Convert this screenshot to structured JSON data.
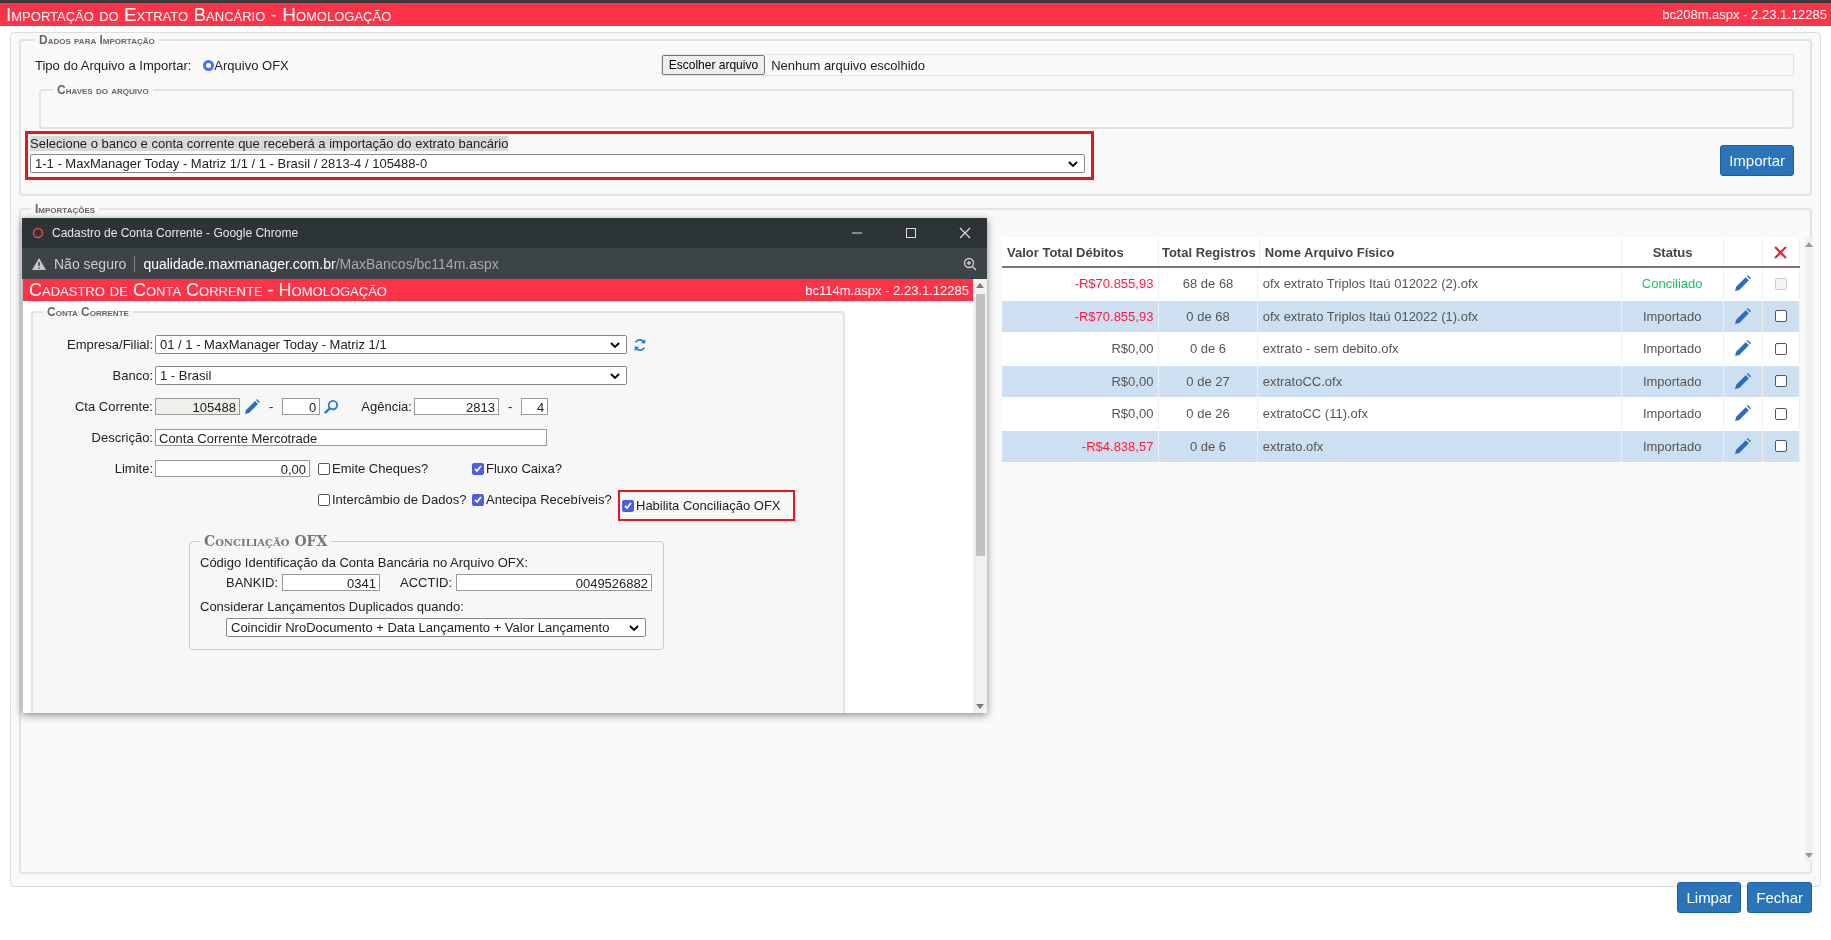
{
  "header": {
    "title": "Importação do Extrato Bancário  - Homologação",
    "file_info": "bc208m.aspx - 2.23.1.12285"
  },
  "dados": {
    "legend": "Dados para Importação",
    "tipo_label": "Tipo do Arquivo a Importar:",
    "radio": {
      "label": "Arquivo OFX",
      "selected": true
    },
    "file_button": "Escolher arquivo",
    "file_status": "Nenhum arquivo escolhido",
    "chaves_legend": "Chaves do arquivo",
    "select_label": "Selecione o banco e conta corrente que receberá a importação do extrato bancário",
    "select_value": "1-1 - MaxManager Today - Matriz 1/1 / 1 - Brasil / 2813-4 / 105488-0",
    "highlighted": true,
    "import_button": "Importar"
  },
  "importacoes": {
    "legend": "Importações",
    "columns": [
      "Valor Total Débitos",
      "Total Registros",
      "Nome Arquivo Físico",
      "Status"
    ],
    "rows": [
      {
        "debit": "-R$70.855,93",
        "negative": true,
        "registros": "68 de 68",
        "file": "ofx extrato Triplos Itaú 012022 (2).ofx",
        "status": "Conciliado",
        "kind": "conciliado",
        "selected": false,
        "checked": false,
        "disabled": true
      },
      {
        "debit": "-R$70.855,93",
        "negative": true,
        "registros": "0 de 68",
        "file": "ofx extrato Triplos Itaú 012022 (1).ofx",
        "status": "Importado",
        "kind": "importado",
        "selected": true,
        "checked": false,
        "disabled": false
      },
      {
        "debit": "R$0,00",
        "negative": false,
        "registros": "0 de 6",
        "file": "extrato - sem debito.ofx",
        "status": "Importado",
        "kind": "importado",
        "selected": false,
        "checked": false,
        "disabled": false
      },
      {
        "debit": "R$0,00",
        "negative": false,
        "registros": "0 de 27",
        "file": "extratoCC.ofx",
        "status": "Importado",
        "kind": "importado",
        "selected": true,
        "checked": false,
        "disabled": false
      },
      {
        "debit": "R$0,00",
        "negative": false,
        "registros": "0 de 26",
        "file": "extratoCC (11).ofx",
        "status": "Importado",
        "kind": "importado",
        "selected": false,
        "checked": false,
        "disabled": false
      },
      {
        "debit": "-R$4.838,57",
        "negative": true,
        "registros": "0 de 6",
        "file": "extrato.ofx",
        "status": "Importado",
        "kind": "importado",
        "selected": true,
        "checked": false,
        "disabled": false
      }
    ]
  },
  "popup": {
    "window_title": "Cadastro de Conta Corrente - Google Chrome",
    "security": "Não seguro",
    "url_host": "qualidade.maxmanager.com.br",
    "url_path": "/MaxBancos/bc114m.aspx",
    "title": "Cadastro de Conta Corrente  - Homologação",
    "file_info": "bc114m.aspx - 2.23.1.12285",
    "legend": "Conta Corrente",
    "empresa_label": "Empresa/Filial:",
    "empresa_value": "01 / 1 - MaxManager Today - Matriz 1/1",
    "banco_label": "Banco:",
    "banco_value": "1 - Brasil",
    "cta_label": "Cta Corrente:",
    "cta_value": "105488",
    "cta_digit": "0",
    "agencia_label": "Agência:",
    "agencia_value": "2813",
    "agencia_digit": "4",
    "dash": "-",
    "descricao_label": "Descrição:",
    "descricao_value": "Conta Corrente Mercotrade",
    "limite_label": "Limite:",
    "limite_value": "0,00",
    "checks": [
      {
        "label": "Emite Cheques?",
        "checked": false
      },
      {
        "label": "Fluxo Caixa?",
        "checked": true
      },
      {
        "label": "Intercâmbio de Dados?",
        "checked": false
      },
      {
        "label": "Antecipa Recebíveis?",
        "checked": true
      },
      {
        "label": "Habilita Conciliação OFX",
        "checked": true,
        "highlighted": true
      }
    ],
    "ofx": {
      "legend": "Conciliação OFX",
      "code_label": "Código Identificação da Conta Bancária no Arquivo OFX:",
      "bankid_label": "BANKID:",
      "bankid_value": "0341",
      "acctid_label": "ACCTID:",
      "acctid_value": "0049526882",
      "dup_label": "Considerar Lançamentos Duplicados quando:",
      "dup_value": "Coincidir NroDocumento + Data Lançamento + Valor Lançamento"
    }
  },
  "buttons": [
    "Limpar",
    "Fechar"
  ]
}
